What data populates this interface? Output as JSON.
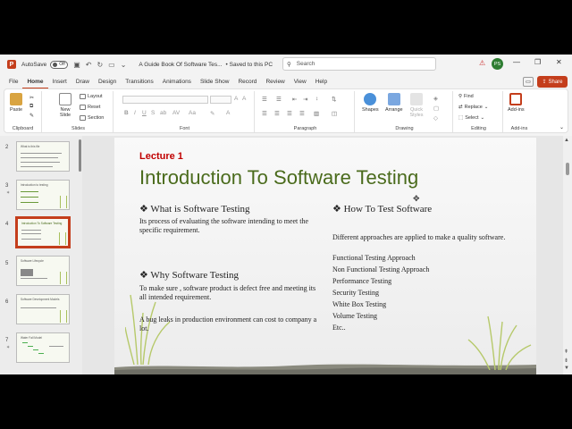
{
  "titlebar": {
    "logo": "P",
    "autosave_label": "AutoSave",
    "autosave_state": "Off",
    "doc_title": "A Guide Book Of Software Tes...",
    "save_status": "• Saved to this PC",
    "search_placeholder": "Search",
    "user_initials": "PS",
    "warning_icon": "warning-icon"
  },
  "menu": {
    "tabs": [
      "File",
      "Home",
      "Insert",
      "Draw",
      "Design",
      "Transitions",
      "Animations",
      "Slide Show",
      "Record",
      "Review",
      "View",
      "Help"
    ],
    "active": "Home",
    "share_label": "Share"
  },
  "ribbon": {
    "clipboard": {
      "label": "Clipboard",
      "paste": "Paste"
    },
    "slides": {
      "label": "Slides",
      "new_slide": "New Slide",
      "layout": "Layout",
      "reset": "Reset",
      "section": "Section"
    },
    "font": {
      "label": "Font"
    },
    "paragraph": {
      "label": "Paragraph"
    },
    "drawing": {
      "label": "Drawing",
      "shapes": "Shapes",
      "arrange": "Arrange",
      "quick_styles": "Quick Styles"
    },
    "editing": {
      "label": "Editing",
      "find": "Find",
      "replace": "Replace",
      "select": "Select"
    },
    "addins": {
      "label": "Add-ins",
      "addins_btn": "Add-ins"
    }
  },
  "thumbnails": {
    "numbers": [
      "2",
      "3",
      "4",
      "5",
      "6",
      "7"
    ],
    "selected": "4",
    "titles": [
      "What is this file",
      "Introduction to testing",
      "Introduction To Software Testing",
      "Software Lifecycle",
      "Software Development Models",
      "Water Fall Model"
    ]
  },
  "slide": {
    "lecture": "Lecture 1",
    "title": "Introduction To Software Testing",
    "left": {
      "h1": "❖ What is Software Testing",
      "p1": "Its process of evaluating the software intending to meet the specific requirement.",
      "h2": "❖ Why Software Testing",
      "p2": "To make sure , software product is defect free and meeting its all intended requirement.",
      "p3": "A bug leaks in production environment can cost to company a lot."
    },
    "right": {
      "h": "❖ How To Test Software",
      "intro": "Different approaches are applied to make a quality software.",
      "items": [
        "Functional Testing Approach",
        "Non Functional Testing Approach",
        "Performance Testing",
        "Security Testing",
        "White Box Testing",
        "Volume Testing",
        "Etc.."
      ]
    }
  },
  "colors": {
    "accent": "#c43e1c",
    "title_green": "#4a6b1c",
    "lecture_red": "#c00000"
  }
}
